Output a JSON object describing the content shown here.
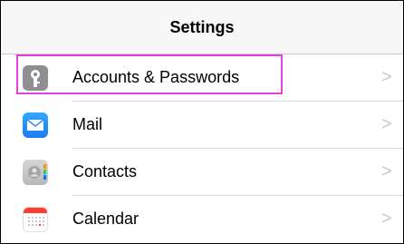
{
  "header": {
    "title": "Settings"
  },
  "rows": [
    {
      "label": "Accounts & Passwords",
      "icon": "key-icon",
      "chevron": ">"
    },
    {
      "label": "Mail",
      "icon": "envelope-icon",
      "chevron": ">"
    },
    {
      "label": "Contacts",
      "icon": "contacts-icon",
      "chevron": ">"
    },
    {
      "label": "Calendar",
      "icon": "calendar-icon",
      "chevron": ">"
    }
  ],
  "colors": {
    "highlight": "#e63ee0",
    "mail": "#1d7cf2",
    "accounts": "#8e8e93"
  }
}
